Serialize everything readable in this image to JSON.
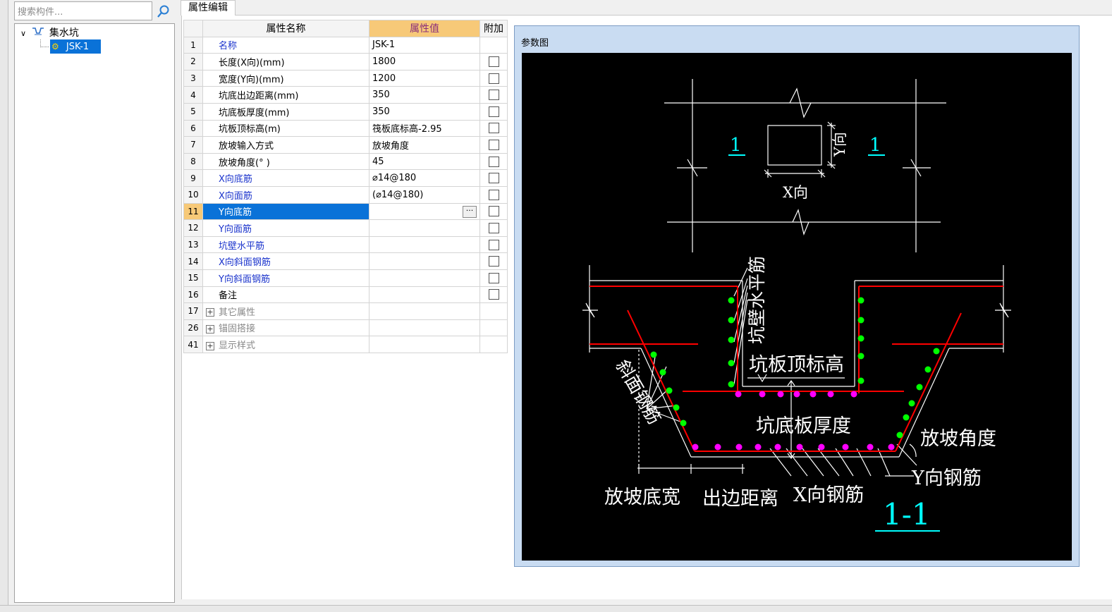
{
  "search": {
    "placeholder": "搜索构件..."
  },
  "tree": {
    "root": "集水坑",
    "child": "JSK-1"
  },
  "tab": {
    "label": "属性编辑"
  },
  "table": {
    "headers": [
      "属性名称",
      "属性值",
      "附加"
    ],
    "rows": [
      {
        "num": "1",
        "name": "名称",
        "value": "JSK-1",
        "style": "blue",
        "check": false
      },
      {
        "num": "2",
        "name": "长度(X向)(mm)",
        "value": "1800",
        "style": "",
        "check": true
      },
      {
        "num": "3",
        "name": "宽度(Y向)(mm)",
        "value": "1200",
        "style": "",
        "check": true
      },
      {
        "num": "4",
        "name": "坑底出边距离(mm)",
        "value": "350",
        "style": "",
        "check": true
      },
      {
        "num": "5",
        "name": "坑底板厚度(mm)",
        "value": "350",
        "style": "",
        "check": true
      },
      {
        "num": "6",
        "name": "坑板顶标高(m)",
        "value": "筏板底标高-2.95",
        "style": "",
        "check": true
      },
      {
        "num": "7",
        "name": "放坡输入方式",
        "value": "放坡角度",
        "style": "",
        "check": true
      },
      {
        "num": "8",
        "name": "放坡角度(° )",
        "value": "45",
        "style": "",
        "check": true
      },
      {
        "num": "9",
        "name": "X向底筋",
        "value": "⌀14@180",
        "style": "blue",
        "check": true
      },
      {
        "num": "10",
        "name": "X向面筋",
        "value": "(⌀14@180)",
        "style": "blue",
        "check": true
      },
      {
        "num": "11",
        "name": "Y向底筋",
        "value": "",
        "style": "blue",
        "check": true,
        "selected": true
      },
      {
        "num": "12",
        "name": "Y向面筋",
        "value": "",
        "style": "blue",
        "check": true
      },
      {
        "num": "13",
        "name": "坑壁水平筋",
        "value": "",
        "style": "blue",
        "check": true
      },
      {
        "num": "14",
        "name": "X向斜面钢筋",
        "value": "",
        "style": "blue",
        "check": true
      },
      {
        "num": "15",
        "name": "Y向斜面钢筋",
        "value": "",
        "style": "blue",
        "check": true
      },
      {
        "num": "16",
        "name": "备注",
        "value": "",
        "style": "",
        "check": true
      },
      {
        "num": "17",
        "name": "其它属性",
        "value": "",
        "style": "group",
        "check": false
      },
      {
        "num": "26",
        "name": "锚固搭接",
        "value": "",
        "style": "group",
        "check": false
      },
      {
        "num": "41",
        "name": "显示样式",
        "value": "",
        "style": "group",
        "check": false
      }
    ]
  },
  "param": {
    "title": "参数图",
    "labels": {
      "sec_left": "1",
      "sec_right": "1",
      "y_dir": "Y向",
      "x_dir": "X向",
      "wall_bar": "坑壁水平筋",
      "top_elev": "坑板顶标高",
      "slope_bar": "斜面钢筋",
      "slab_thk": "坑底板厚度",
      "slope_angle": "放坡角度",
      "y_bar": "Y向钢筋",
      "slope_width": "放坡底宽",
      "edge_dist": "出边距离",
      "x_bar": "X向钢筋",
      "section": "1-1"
    }
  },
  "colors": {
    "accent": "#0a72d8",
    "header_value": "#f7c978",
    "blue_text": "#1a33cc",
    "rebar_red": "#ff0000",
    "rebar_green": "#00ff00",
    "rebar_magenta": "#ff00ff",
    "cyan": "#00ffff"
  }
}
